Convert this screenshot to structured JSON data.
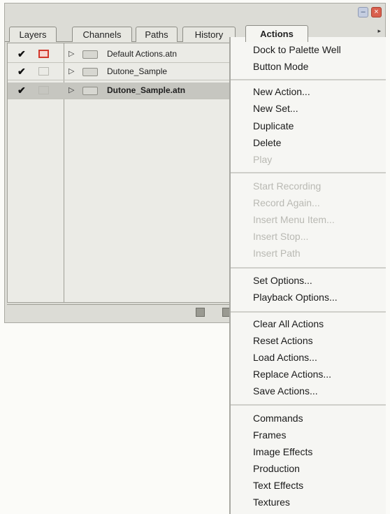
{
  "window": {
    "minimize_glyph": "–",
    "close_glyph": "×"
  },
  "tabs": [
    {
      "label": "Layers"
    },
    {
      "label": "Channels"
    },
    {
      "label": "Paths"
    },
    {
      "label": "History"
    },
    {
      "label": "Actions",
      "active": true
    }
  ],
  "actions_list": [
    {
      "label": "Default Actions.atn",
      "checked": true,
      "modal_on": true
    },
    {
      "label": "Dutone_Sample",
      "checked": true,
      "modal_on": false
    },
    {
      "label": "Dutone_Sample.atn",
      "checked": true,
      "modal_on": false,
      "selected": true
    }
  ],
  "glyphs": {
    "check": "✔",
    "expand": "▷"
  },
  "menu": {
    "groups": [
      [
        {
          "label": "Dock to Palette Well"
        },
        {
          "label": "Button Mode"
        }
      ],
      [
        {
          "label": "New Action..."
        },
        {
          "label": "New Set..."
        },
        {
          "label": "Duplicate"
        },
        {
          "label": "Delete"
        },
        {
          "label": "Play",
          "disabled": true
        }
      ],
      [
        {
          "label": "Start Recording",
          "disabled": true
        },
        {
          "label": "Record Again...",
          "disabled": true
        },
        {
          "label": "Insert Menu Item...",
          "disabled": true
        },
        {
          "label": "Insert Stop...",
          "disabled": true
        },
        {
          "label": "Insert Path",
          "disabled": true
        }
      ],
      [
        {
          "label": "Set Options..."
        },
        {
          "label": "Playback Options..."
        }
      ],
      [
        {
          "label": "Clear All Actions"
        },
        {
          "label": "Reset Actions"
        },
        {
          "label": "Load Actions..."
        },
        {
          "label": "Replace Actions..."
        },
        {
          "label": "Save Actions..."
        }
      ],
      [
        {
          "label": "Commands"
        },
        {
          "label": "Frames"
        },
        {
          "label": "Image Effects"
        },
        {
          "label": "Production"
        },
        {
          "label": "Text Effects"
        },
        {
          "label": "Textures"
        }
      ]
    ]
  }
}
